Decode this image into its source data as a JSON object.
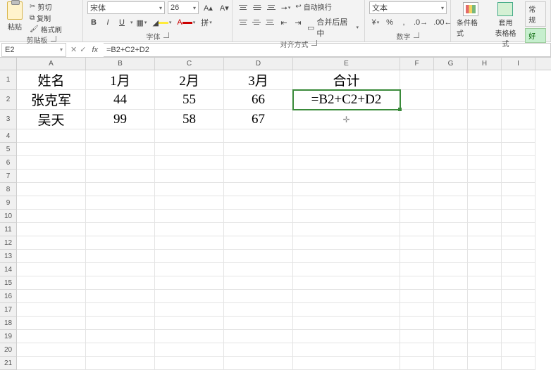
{
  "ribbon": {
    "clipboard": {
      "label": "剪贴板",
      "paste": "粘贴",
      "cut": "剪切",
      "copy": "复制",
      "painter": "格式刷"
    },
    "font": {
      "label": "字体",
      "family": "宋体",
      "size": "26",
      "bold": "B",
      "italic": "I",
      "underline": "U"
    },
    "alignment": {
      "label": "对齐方式",
      "wrap": "自动换行",
      "merge": "合并后居中"
    },
    "number": {
      "label": "数字",
      "format": "文本"
    },
    "styles": {
      "cond": "条件格式",
      "table": "套用\n表格格式",
      "good": "好",
      "normal": "常规"
    }
  },
  "namebox": "E2",
  "formula": "=B2+C2+D2",
  "columns": [
    "A",
    "B",
    "C",
    "D",
    "E",
    "F",
    "G",
    "H",
    "I"
  ],
  "rowcount": 21,
  "data": {
    "A1": "姓名",
    "B1": "1月",
    "C1": "2月",
    "D1": "3月",
    "E1": "合计",
    "A2": "张克军",
    "B2": "44",
    "C2": "55",
    "D2": "66",
    "E2": "=B2+C2+D2",
    "A3": "吴天",
    "B3": "99",
    "C3": "58",
    "D3": "67"
  },
  "selected": "E2"
}
